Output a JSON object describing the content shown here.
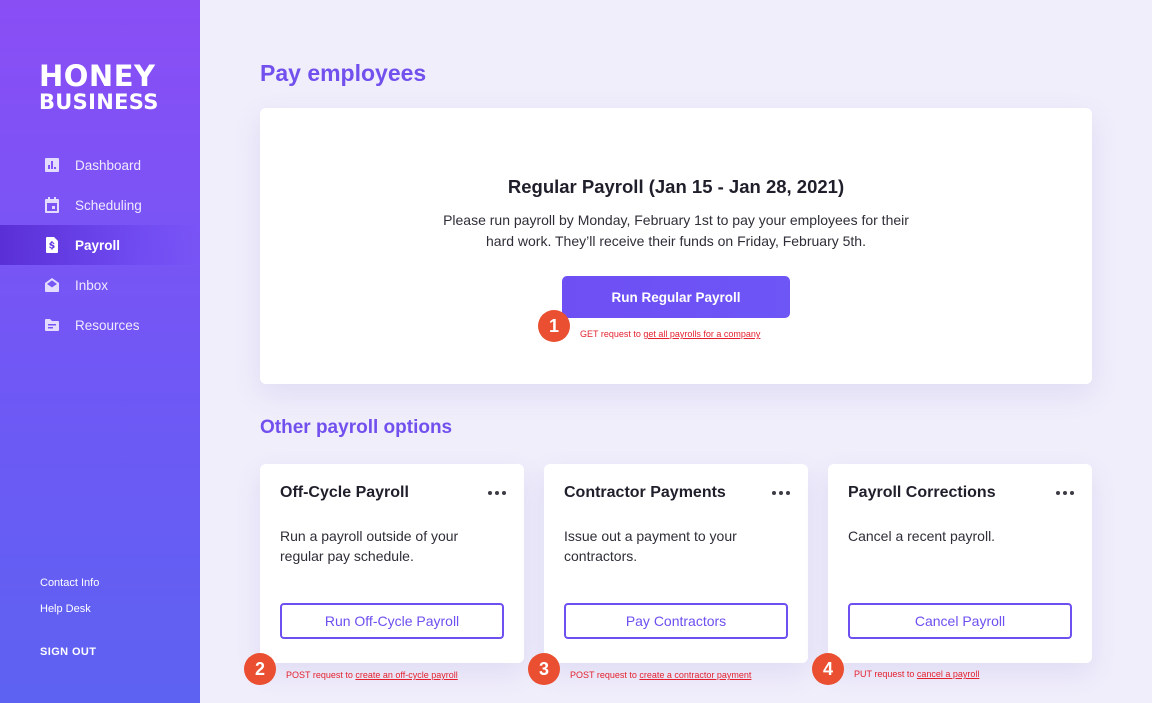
{
  "brand": {
    "line1": "HONEY",
    "line2": "BUSINESS"
  },
  "nav": [
    {
      "label": "Dashboard",
      "icon": "chart-icon"
    },
    {
      "label": "Scheduling",
      "icon": "calendar-icon"
    },
    {
      "label": "Payroll",
      "icon": "dollar-file-icon",
      "active": true
    },
    {
      "label": "Inbox",
      "icon": "envelope-icon"
    },
    {
      "label": "Resources",
      "icon": "folder-icon"
    }
  ],
  "footer": {
    "contact": "Contact Info",
    "help": "Help Desk",
    "signout": "SIGN OUT"
  },
  "page_title": "Pay employees",
  "hero": {
    "title": "Regular Payroll (Jan 15 - Jan 28, 2021)",
    "desc": "Please run payroll by Monday, February 1st to pay your employees for their hard work. They’ll receive their funds on Friday, February 5th.",
    "button": "Run Regular Payroll",
    "badge": "1",
    "note_prefix": "GET request to ",
    "note_link": "get all payrolls for a company"
  },
  "options_title": "Other payroll options",
  "cards": [
    {
      "title": "Off-Cycle Payroll",
      "desc": "Run a payroll outside of your regular pay schedule.",
      "button": "Run Off-Cycle Payroll",
      "badge": "2",
      "note_prefix": "POST request to ",
      "note_link": "create an off-cycle payroll"
    },
    {
      "title": "Contractor Payments",
      "desc": "Issue out a payment to your contractors.",
      "button": "Pay Contractors",
      "badge": "3",
      "note_prefix": "POST request to ",
      "note_link": "create a contractor payment"
    },
    {
      "title": "Payroll Corrections",
      "desc": "Cancel a recent payroll.",
      "button": "Cancel Payroll",
      "badge": "4",
      "note_prefix": "PUT request to ",
      "note_link": "cancel a payroll"
    }
  ],
  "colors": {
    "accent": "#7250ee",
    "badge": "#e94f30",
    "note": "#e4222f"
  }
}
